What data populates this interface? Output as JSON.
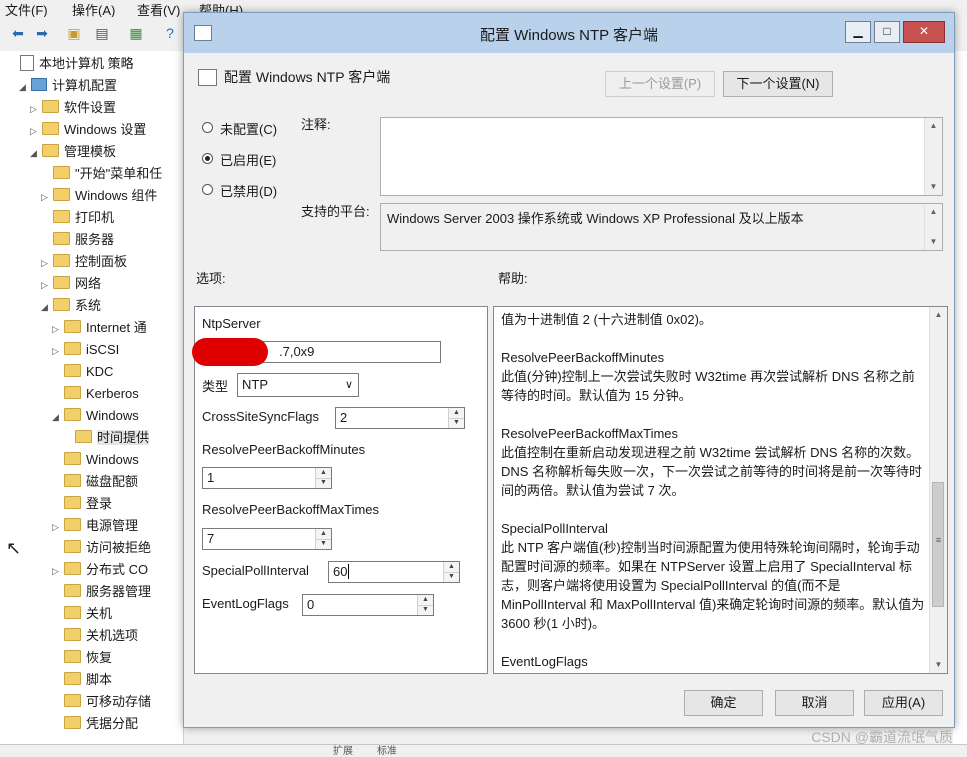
{
  "mmc": {
    "menu": [
      "文件(F)",
      "操作(A)",
      "查看(V)",
      "帮助(H)"
    ],
    "tree": [
      {
        "label": "本地计算机 策略",
        "depth": 0,
        "icon": "doc",
        "exp": ""
      },
      {
        "label": "计算机配置",
        "depth": 1,
        "icon": "pc",
        "exp": "◢"
      },
      {
        "label": "软件设置",
        "depth": 2,
        "icon": "folder",
        "exp": "▷"
      },
      {
        "label": "Windows 设置",
        "depth": 2,
        "icon": "folder",
        "exp": "▷"
      },
      {
        "label": "管理模板",
        "depth": 2,
        "icon": "folder",
        "exp": "◢"
      },
      {
        "label": "\"开始\"菜单和任",
        "depth": 3,
        "icon": "folder",
        "exp": ""
      },
      {
        "label": "Windows 组件",
        "depth": 3,
        "icon": "folder",
        "exp": "▷"
      },
      {
        "label": "打印机",
        "depth": 3,
        "icon": "folder",
        "exp": ""
      },
      {
        "label": "服务器",
        "depth": 3,
        "icon": "folder",
        "exp": ""
      },
      {
        "label": "控制面板",
        "depth": 3,
        "icon": "folder",
        "exp": "▷"
      },
      {
        "label": "网络",
        "depth": 3,
        "icon": "folder",
        "exp": "▷"
      },
      {
        "label": "系统",
        "depth": 3,
        "icon": "folder",
        "exp": "◢"
      },
      {
        "label": "Internet 通",
        "depth": 4,
        "icon": "folder",
        "exp": "▷"
      },
      {
        "label": "iSCSI",
        "depth": 4,
        "icon": "folder",
        "exp": "▷"
      },
      {
        "label": "KDC",
        "depth": 4,
        "icon": "folder",
        "exp": ""
      },
      {
        "label": "Kerberos",
        "depth": 4,
        "icon": "folder",
        "exp": ""
      },
      {
        "label": "Windows",
        "depth": 4,
        "icon": "folder",
        "exp": "◢"
      },
      {
        "label": "时间提供",
        "depth": 5,
        "icon": "folder",
        "exp": ""
      },
      {
        "label": "Windows",
        "depth": 4,
        "icon": "folder",
        "exp": ""
      },
      {
        "label": "磁盘配额",
        "depth": 4,
        "icon": "folder",
        "exp": ""
      },
      {
        "label": "登录",
        "depth": 4,
        "icon": "folder",
        "exp": ""
      },
      {
        "label": "电源管理",
        "depth": 4,
        "icon": "folder",
        "exp": "▷"
      },
      {
        "label": "访问被拒绝",
        "depth": 4,
        "icon": "folder",
        "exp": ""
      },
      {
        "label": "分布式 CO",
        "depth": 4,
        "icon": "folder",
        "exp": "▷"
      },
      {
        "label": "服务器管理",
        "depth": 4,
        "icon": "folder",
        "exp": ""
      },
      {
        "label": "关机",
        "depth": 4,
        "icon": "folder",
        "exp": ""
      },
      {
        "label": "关机选项",
        "depth": 4,
        "icon": "folder",
        "exp": ""
      },
      {
        "label": "恢复",
        "depth": 4,
        "icon": "folder",
        "exp": ""
      },
      {
        "label": "脚本",
        "depth": 4,
        "icon": "folder",
        "exp": ""
      },
      {
        "label": "可移动存储",
        "depth": 4,
        "icon": "folder",
        "exp": ""
      },
      {
        "label": "凭据分配",
        "depth": 4,
        "icon": "folder",
        "exp": ""
      }
    ],
    "bottom_tabs": [
      "扩展",
      "标准"
    ]
  },
  "dialog": {
    "title": "配置 Windows NTP 客户端",
    "header": "配置 Windows NTP 客户端",
    "prev_button": "上一个设置(P)",
    "next_button": "下一个设置(N)",
    "radios": [
      {
        "label": "未配置(C)",
        "checked": false
      },
      {
        "label": "已启用(E)",
        "checked": true
      },
      {
        "label": "已禁用(D)",
        "checked": false
      }
    ],
    "comment_label": "注释:",
    "platform_label": "支持的平台:",
    "platform_text": "Windows Server 2003 操作系统或 Windows XP Professional 及以上版本",
    "options_label": "选项:",
    "help_label": "帮助:",
    "options": {
      "ntpserver_label": "NtpServer",
      "ntpserver_value": ".7,0x9",
      "type_label": "类型",
      "type_value": "NTP",
      "cross_label": "CrossSiteSyncFlags",
      "cross_value": "2",
      "backoff_min_label": "ResolvePeerBackoffMinutes",
      "backoff_min_value": "1",
      "backoff_max_label": "ResolvePeerBackoffMaxTimes",
      "backoff_max_value": "7",
      "poll_label": "SpecialPollInterval",
      "poll_value": "60",
      "eventlog_label": "EventLogFlags",
      "eventlog_value": "0"
    },
    "help": [
      "值为十进制值 2 (十六进制值 0x02)。",
      "",
      "ResolvePeerBackoffMinutes",
      "此值(分钟)控制上一次尝试失败时 W32time 再次尝试解析 DNS 名称之前等待的时间。默认值为 15 分钟。",
      "",
      "ResolvePeerBackoffMaxTimes",
      "此值控制在重新启动发现进程之前 W32time 尝试解析 DNS 名称的次数。DNS 名称解析每失败一次，下一次尝试之前等待的时间将是前一次等待时间的两倍。默认值为尝试 7 次。",
      "",
      "SpecialPollInterval",
      "此 NTP 客户端值(秒)控制当时间源配置为使用特殊轮询间隔时，轮询手动配置时间源的频率。如果在 NTPServer 设置上启用了 SpecialInterval 标志，则客户端将使用设置为 SpecialPollInterval 的值(而不是 MinPollInterval 和 MaxPollInterval 值)来确定轮询时间源的频率。默认值为 3600 秒(1 小时)。",
      "",
      "EventLogFlags"
    ],
    "ok_button": "确定",
    "cancel_button": "取消",
    "apply_button": "应用(A)"
  },
  "watermark": "CSDN @霸道流氓气质"
}
